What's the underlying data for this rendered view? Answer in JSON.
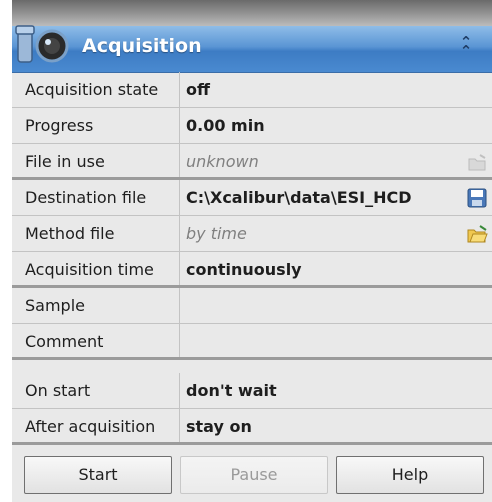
{
  "panel": {
    "title": "Acquisition",
    "icon": "camera-icon",
    "collapse_icon": "double-chevron-up-icon"
  },
  "rows": [
    {
      "label": "Acquisition state",
      "value": "off"
    },
    {
      "label": "Progress",
      "value": "0.00 min"
    },
    {
      "label": "File in use",
      "value": "unknown"
    },
    {
      "label": "Destination file",
      "value": "C:\\Xcalibur\\data\\ESI_HCD"
    },
    {
      "label": "Method file",
      "value": "by time"
    },
    {
      "label": "Acquisition time",
      "value": "continuously"
    },
    {
      "label": "Sample",
      "value": ""
    },
    {
      "label": "Comment",
      "value": ""
    },
    {
      "label": "On start",
      "value": "don't wait"
    },
    {
      "label": "After acquisition",
      "value": "stay on"
    }
  ],
  "buttons": {
    "start": "Start",
    "pause": "Pause",
    "help": "Help"
  },
  "colors": {
    "header_accent": "#4a8ad0",
    "panel_bg": "#e9e9e9",
    "disabled_text": "#9a9a9a"
  }
}
